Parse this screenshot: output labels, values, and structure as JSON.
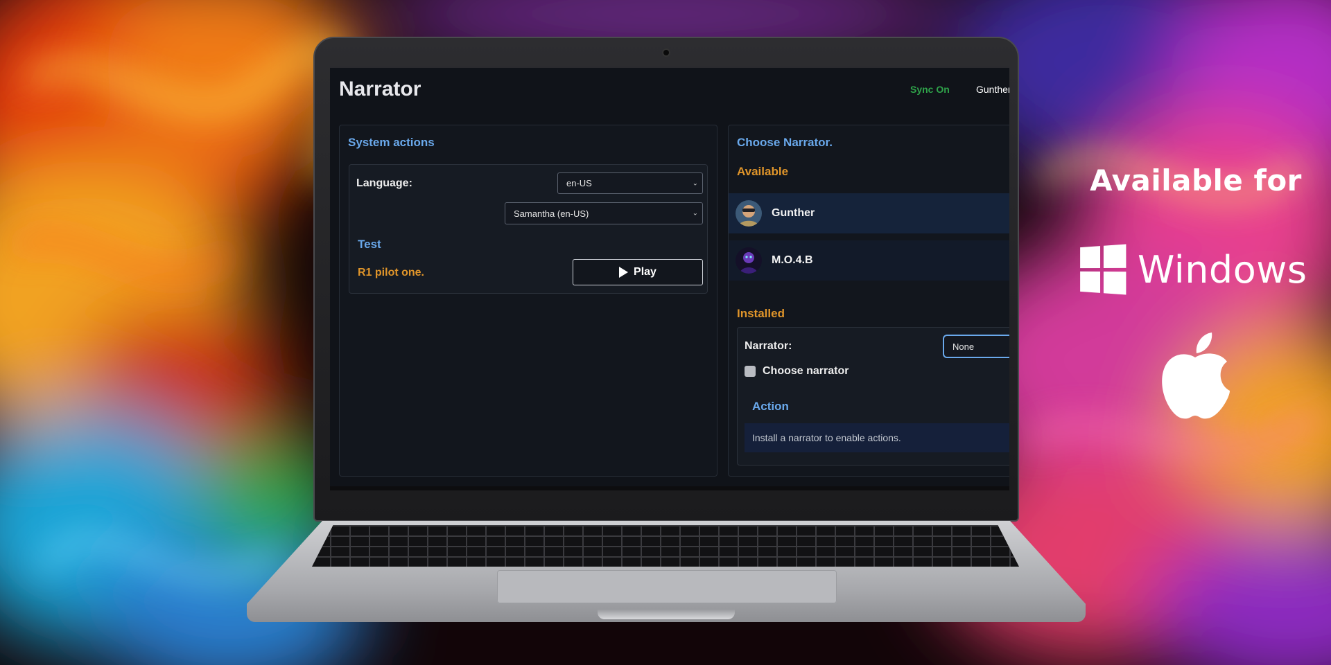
{
  "app": {
    "title": "Narrator",
    "sync_status": "Sync On",
    "user_name": "Gunther"
  },
  "system_actions": {
    "title": "System actions",
    "language_label": "Language:",
    "language_value": "en-US",
    "voice_value": "Samantha (en-US)",
    "test_title": "Test",
    "test_text": "R1 pilot one.",
    "play_label": "Play"
  },
  "choose_narrator": {
    "title": "Choose Narrator.",
    "available_title": "Available",
    "available": [
      {
        "name": "Gunther"
      },
      {
        "name": "M.O.4.B"
      }
    ],
    "installed_title": "Installed",
    "narrator_label": "Narrator:",
    "narrator_value": "None",
    "choose_label": "Choose narrator",
    "choose_checked": false,
    "action_title": "Action",
    "action_message": "Install a narrator to enable actions."
  },
  "promo": {
    "title": "Available for",
    "platform_windows": "Windows",
    "platform_apple_icon": "apple-icon"
  },
  "colors": {
    "accent_blue": "#6aa9ec",
    "accent_orange": "#e0952a",
    "sync_green": "#2fa34a",
    "screen_bg": "#101319"
  }
}
